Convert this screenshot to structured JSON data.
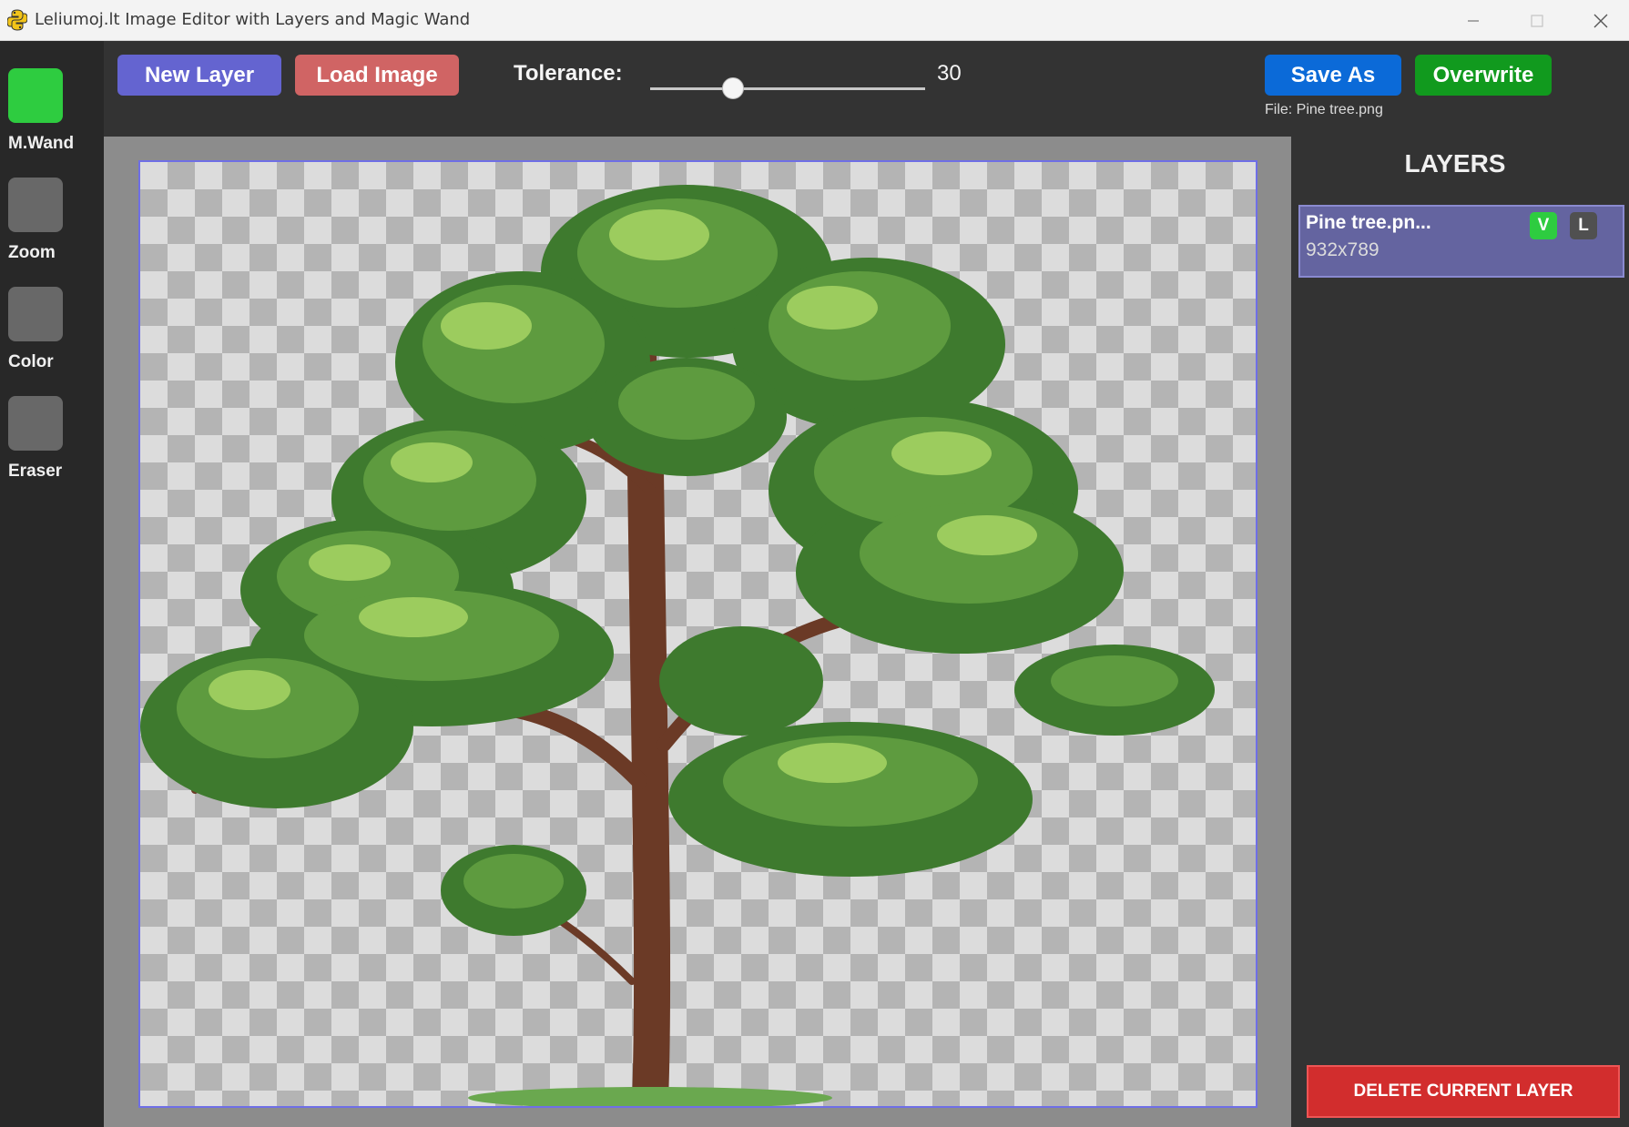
{
  "window": {
    "title": "Leliumoj.lt Image Editor with Layers and Magic Wand",
    "app_icon": "python-icon",
    "controls": [
      "minimize-icon",
      "maximize-icon",
      "close-icon"
    ]
  },
  "tools": [
    {
      "label": "M.Wand",
      "active": true
    },
    {
      "label": "Zoom",
      "active": false
    },
    {
      "label": "Color",
      "active": false
    },
    {
      "label": "Eraser",
      "active": false
    }
  ],
  "topbar": {
    "new_layer_label": "New Layer",
    "load_image_label": "Load Image",
    "tolerance_label": "Tolerance:",
    "tolerance_value": "30",
    "tolerance_fraction": 0.3,
    "save_as_label": "Save As",
    "overwrite_label": "Overwrite",
    "file_label": "File: Pine tree.png"
  },
  "canvas": {
    "content": "pine tree image on transparent background"
  },
  "layers": {
    "title": "LAYERS",
    "items": [
      {
        "name": "Pine tree.pn...",
        "size": "932x789",
        "visible_badge": "V",
        "lock_badge": "L",
        "selected": true
      }
    ],
    "delete_label": "DELETE CURRENT LAYER"
  },
  "colors": {
    "active_tool": "#2ecc40",
    "new_layer": "#6464d0",
    "load_image": "#d06464",
    "save_as": "#0b6ad8",
    "overwrite": "#119a1e",
    "delete": "#d22d2d",
    "selected_layer": "#6464a0"
  }
}
